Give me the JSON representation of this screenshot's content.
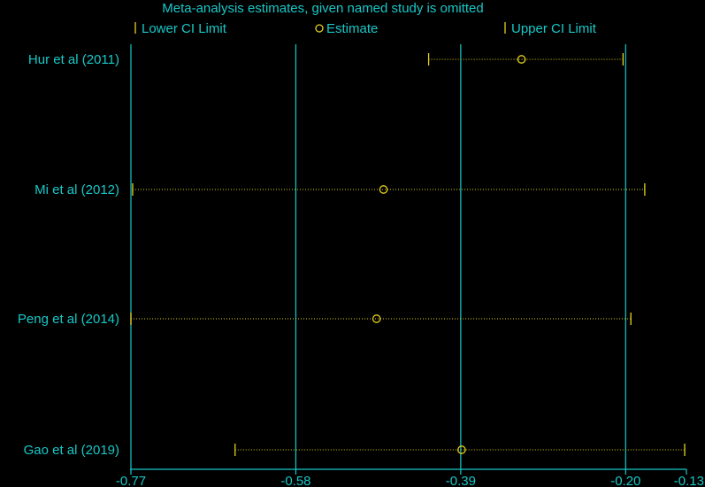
{
  "chart_data": {
    "type": "scatter",
    "title": "Meta-analysis estimates, given named study is omitted",
    "legend": {
      "placement": "top",
      "entries": [
        {
          "key": "lower",
          "label": "Lower CI Limit"
        },
        {
          "key": "estimate",
          "label": "Estimate"
        },
        {
          "key": "upper",
          "label": "Upper CI Limit"
        }
      ]
    },
    "studies": [
      "Hur et al (2011)",
      "Mi et al (2012)",
      "Peng et al (2014)",
      "Gao et al (2019)"
    ],
    "series": [
      {
        "name": "Lower CI Limit",
        "values": [
          -0.427,
          -0.768,
          -0.77,
          -0.65
        ]
      },
      {
        "name": "Estimate",
        "values": [
          -0.32,
          -0.479,
          -0.487,
          -0.389
        ]
      },
      {
        "name": "Upper CI Limit",
        "values": [
          -0.203,
          -0.178,
          -0.194,
          -0.132
        ]
      }
    ],
    "x_ticks": [
      {
        "value": -0.77,
        "label": "-0.77"
      },
      {
        "value": -0.58,
        "label": "-0.58"
      },
      {
        "value": -0.39,
        "label": "-0.39"
      },
      {
        "value": -0.2,
        "label": "-0.20"
      },
      {
        "value": -0.13,
        "label": "-0.13"
      }
    ],
    "reference_lines": [
      -0.77,
      -0.58,
      -0.39,
      -0.2
    ],
    "xlim": [
      -0.77,
      -0.13
    ],
    "grid": false,
    "colors": {
      "background": "#000000",
      "axis": "#17c8c8",
      "text": "#17c8c8",
      "marker": "#e6d21e",
      "label": "#17c8c8"
    }
  }
}
